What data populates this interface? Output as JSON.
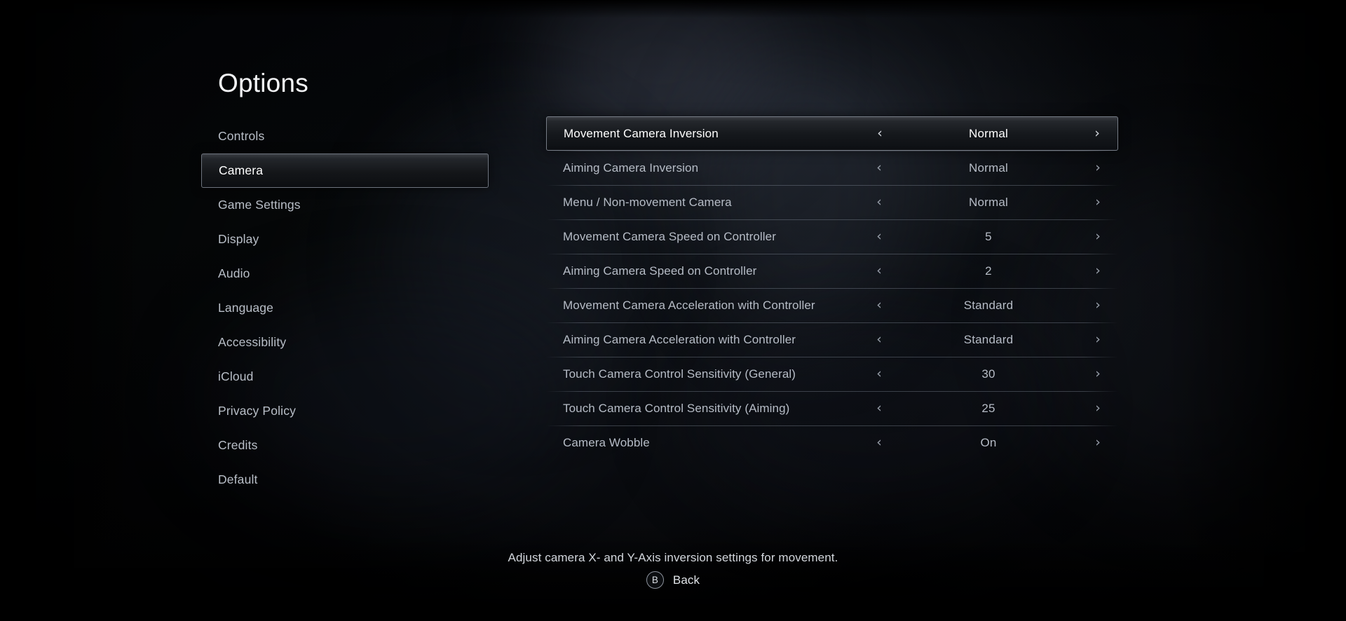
{
  "page": {
    "title": "Options"
  },
  "sidebar": {
    "items": [
      {
        "label": "Controls",
        "selected": false
      },
      {
        "label": "Camera",
        "selected": true
      },
      {
        "label": "Game Settings",
        "selected": false
      },
      {
        "label": "Display",
        "selected": false
      },
      {
        "label": "Audio",
        "selected": false
      },
      {
        "label": "Language",
        "selected": false
      },
      {
        "label": "Accessibility",
        "selected": false
      },
      {
        "label": "iCloud",
        "selected": false
      },
      {
        "label": "Privacy Policy",
        "selected": false
      },
      {
        "label": "Credits",
        "selected": false
      },
      {
        "label": "Default",
        "selected": false
      }
    ]
  },
  "settings": {
    "left_arrow": "‹",
    "right_arrow": "›",
    "rows": [
      {
        "label": "Movement Camera Inversion",
        "value": "Normal",
        "selected": true
      },
      {
        "label": "Aiming Camera Inversion",
        "value": "Normal",
        "selected": false
      },
      {
        "label": "Menu / Non-movement Camera",
        "value": "Normal",
        "selected": false
      },
      {
        "label": "Movement Camera Speed on Controller",
        "value": "5",
        "selected": false
      },
      {
        "label": "Aiming Camera Speed on Controller",
        "value": "2",
        "selected": false
      },
      {
        "label": "Movement Camera Acceleration with Controller",
        "value": "Standard",
        "selected": false
      },
      {
        "label": "Aiming Camera Acceleration with Controller",
        "value": "Standard",
        "selected": false
      },
      {
        "label": "Touch Camera Control Sensitivity (General)",
        "value": "30",
        "selected": false
      },
      {
        "label": "Touch Camera Control Sensitivity (Aiming)",
        "value": "25",
        "selected": false
      },
      {
        "label": "Camera Wobble",
        "value": "On",
        "selected": false
      }
    ]
  },
  "footer": {
    "hint": "Adjust camera X- and Y-Axis inversion settings for movement.",
    "back_button_glyph": "B",
    "back_label": "Back"
  },
  "colors": {
    "background": "#040508",
    "text_primary": "#ffffff",
    "text_secondary": "#b6bcc6",
    "highlight_border": "#767c86"
  }
}
